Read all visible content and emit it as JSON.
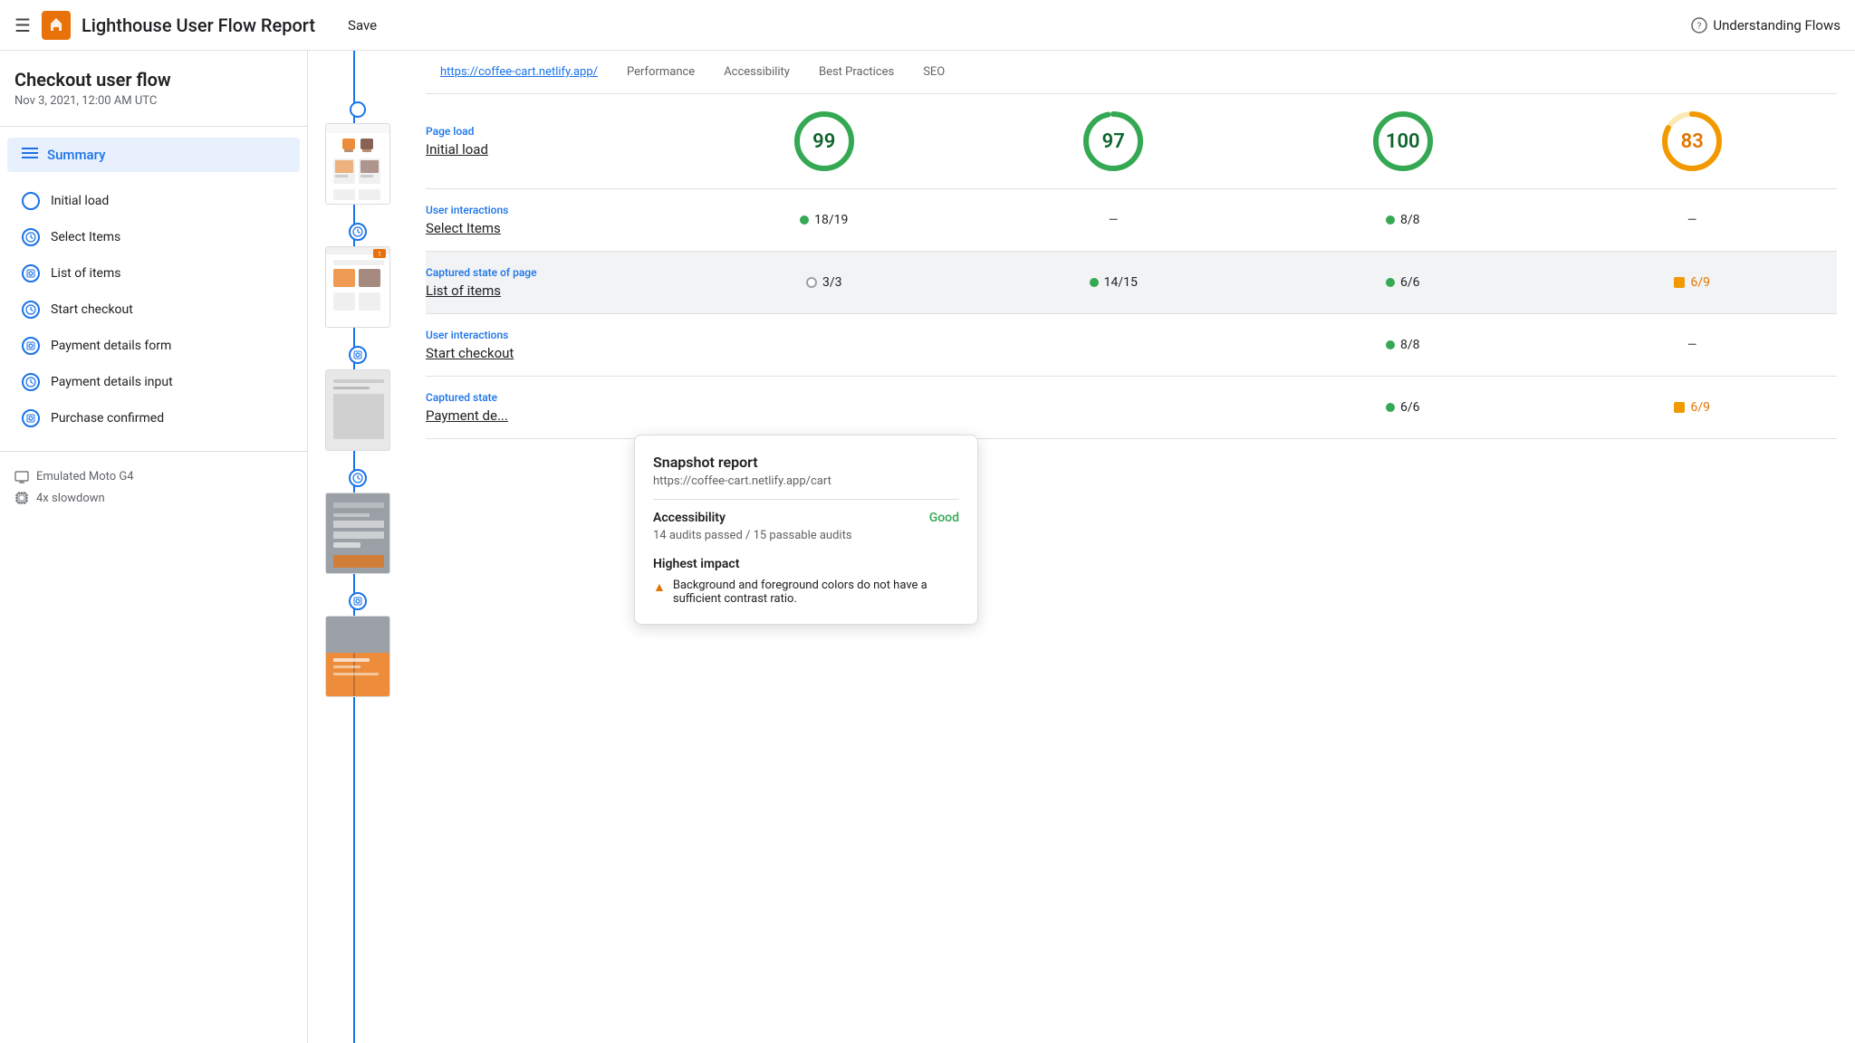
{
  "topbar": {
    "menu_icon": "☰",
    "logo_text": "🔦",
    "title": "Lighthouse User Flow Report",
    "save_label": "Save",
    "help_icon": "?",
    "help_label": "Understanding Flows"
  },
  "sidebar": {
    "flow_title": "Checkout user flow",
    "flow_date": "Nov 3, 2021, 12:00 AM UTC",
    "summary_label": "Summary",
    "steps": [
      {
        "id": "initial-load",
        "label": "Initial load",
        "type": "circle"
      },
      {
        "id": "select-items",
        "label": "Select Items",
        "type": "clock"
      },
      {
        "id": "list-of-items",
        "label": "List of items",
        "type": "snapshot"
      },
      {
        "id": "start-checkout",
        "label": "Start checkout",
        "type": "clock"
      },
      {
        "id": "payment-details-form",
        "label": "Payment details form",
        "type": "snapshot"
      },
      {
        "id": "payment-details-input",
        "label": "Payment details input",
        "type": "clock"
      },
      {
        "id": "purchase-confirmed",
        "label": "Purchase confirmed",
        "type": "snapshot"
      }
    ],
    "footer": {
      "device_icon": "device",
      "device_label": "Emulated Moto G4",
      "slowdown_icon": "cpu",
      "slowdown_label": "4x slowdown"
    }
  },
  "content": {
    "tabs": [
      {
        "id": "url",
        "label": "https://coffee-cart.netlify.app/",
        "type": "url"
      },
      {
        "id": "performance",
        "label": "Performance"
      },
      {
        "id": "accessibility",
        "label": "Accessibility"
      },
      {
        "id": "best-practices",
        "label": "Best Practices"
      },
      {
        "id": "seo",
        "label": "SEO"
      }
    ],
    "sections": [
      {
        "type_label": "Page load",
        "name": "Initial load",
        "scores": {
          "performance": {
            "value": "99",
            "type": "circle",
            "color": "green"
          },
          "accessibility": {
            "value": "97",
            "type": "circle",
            "color": "green"
          },
          "best_practices": {
            "value": "100",
            "type": "circle",
            "color": "green"
          },
          "seo": {
            "value": "83",
            "type": "circle",
            "color": "orange"
          }
        }
      },
      {
        "type_label": "User interactions",
        "name": "Select Items",
        "scores": {
          "performance": {
            "value": "18/19",
            "type": "badge",
            "color": "green"
          },
          "accessibility": {
            "value": "–",
            "type": "dash"
          },
          "best_practices": {
            "value": "8/8",
            "type": "badge",
            "color": "green"
          },
          "seo": {
            "value": "–",
            "type": "dash"
          }
        }
      },
      {
        "type_label": "Captured state of page",
        "name": "List of items",
        "highlighted": true,
        "scores": {
          "performance": {
            "value": "3/3",
            "type": "badge-outlined",
            "color": "gray"
          },
          "accessibility": {
            "value": "14/15",
            "type": "badge",
            "color": "green"
          },
          "best_practices": {
            "value": "6/6",
            "type": "badge",
            "color": "green"
          },
          "seo": {
            "value": "6/9",
            "type": "badge",
            "color": "orange"
          }
        }
      },
      {
        "type_label": "User interactions",
        "name": "Start checkout",
        "scores": {
          "performance": {
            "value": "",
            "type": "hidden"
          },
          "accessibility": {
            "value": "",
            "type": "hidden"
          },
          "best_practices": {
            "value": "8/8",
            "type": "badge",
            "color": "green"
          },
          "seo": {
            "value": "–",
            "type": "dash"
          }
        }
      },
      {
        "type_label": "Captured state",
        "name": "Payment de...",
        "scores": {
          "performance": {
            "value": "",
            "type": "hidden"
          },
          "accessibility": {
            "value": "",
            "type": "hidden"
          },
          "best_practices": {
            "value": "6/6",
            "type": "badge",
            "color": "green"
          },
          "seo": {
            "value": "6/9",
            "type": "badge",
            "color": "orange"
          }
        }
      }
    ]
  },
  "tooltip": {
    "title": "Snapshot report",
    "url": "https://coffee-cart.netlify.app/cart",
    "accessibility_label": "Accessibility",
    "accessibility_status": "Good",
    "accessibility_desc": "14 audits passed / 15 passable audits",
    "highest_impact_label": "Highest impact",
    "impact_items": [
      {
        "icon": "▲",
        "text": "Background and foreground colors do not have a sufficient contrast ratio."
      }
    ]
  },
  "colors": {
    "green_circle": "#34a853",
    "orange_circle": "#e37400",
    "blue_accent": "#1a73e8",
    "green_text": "#0d652d",
    "orange_text": "#e37400"
  }
}
